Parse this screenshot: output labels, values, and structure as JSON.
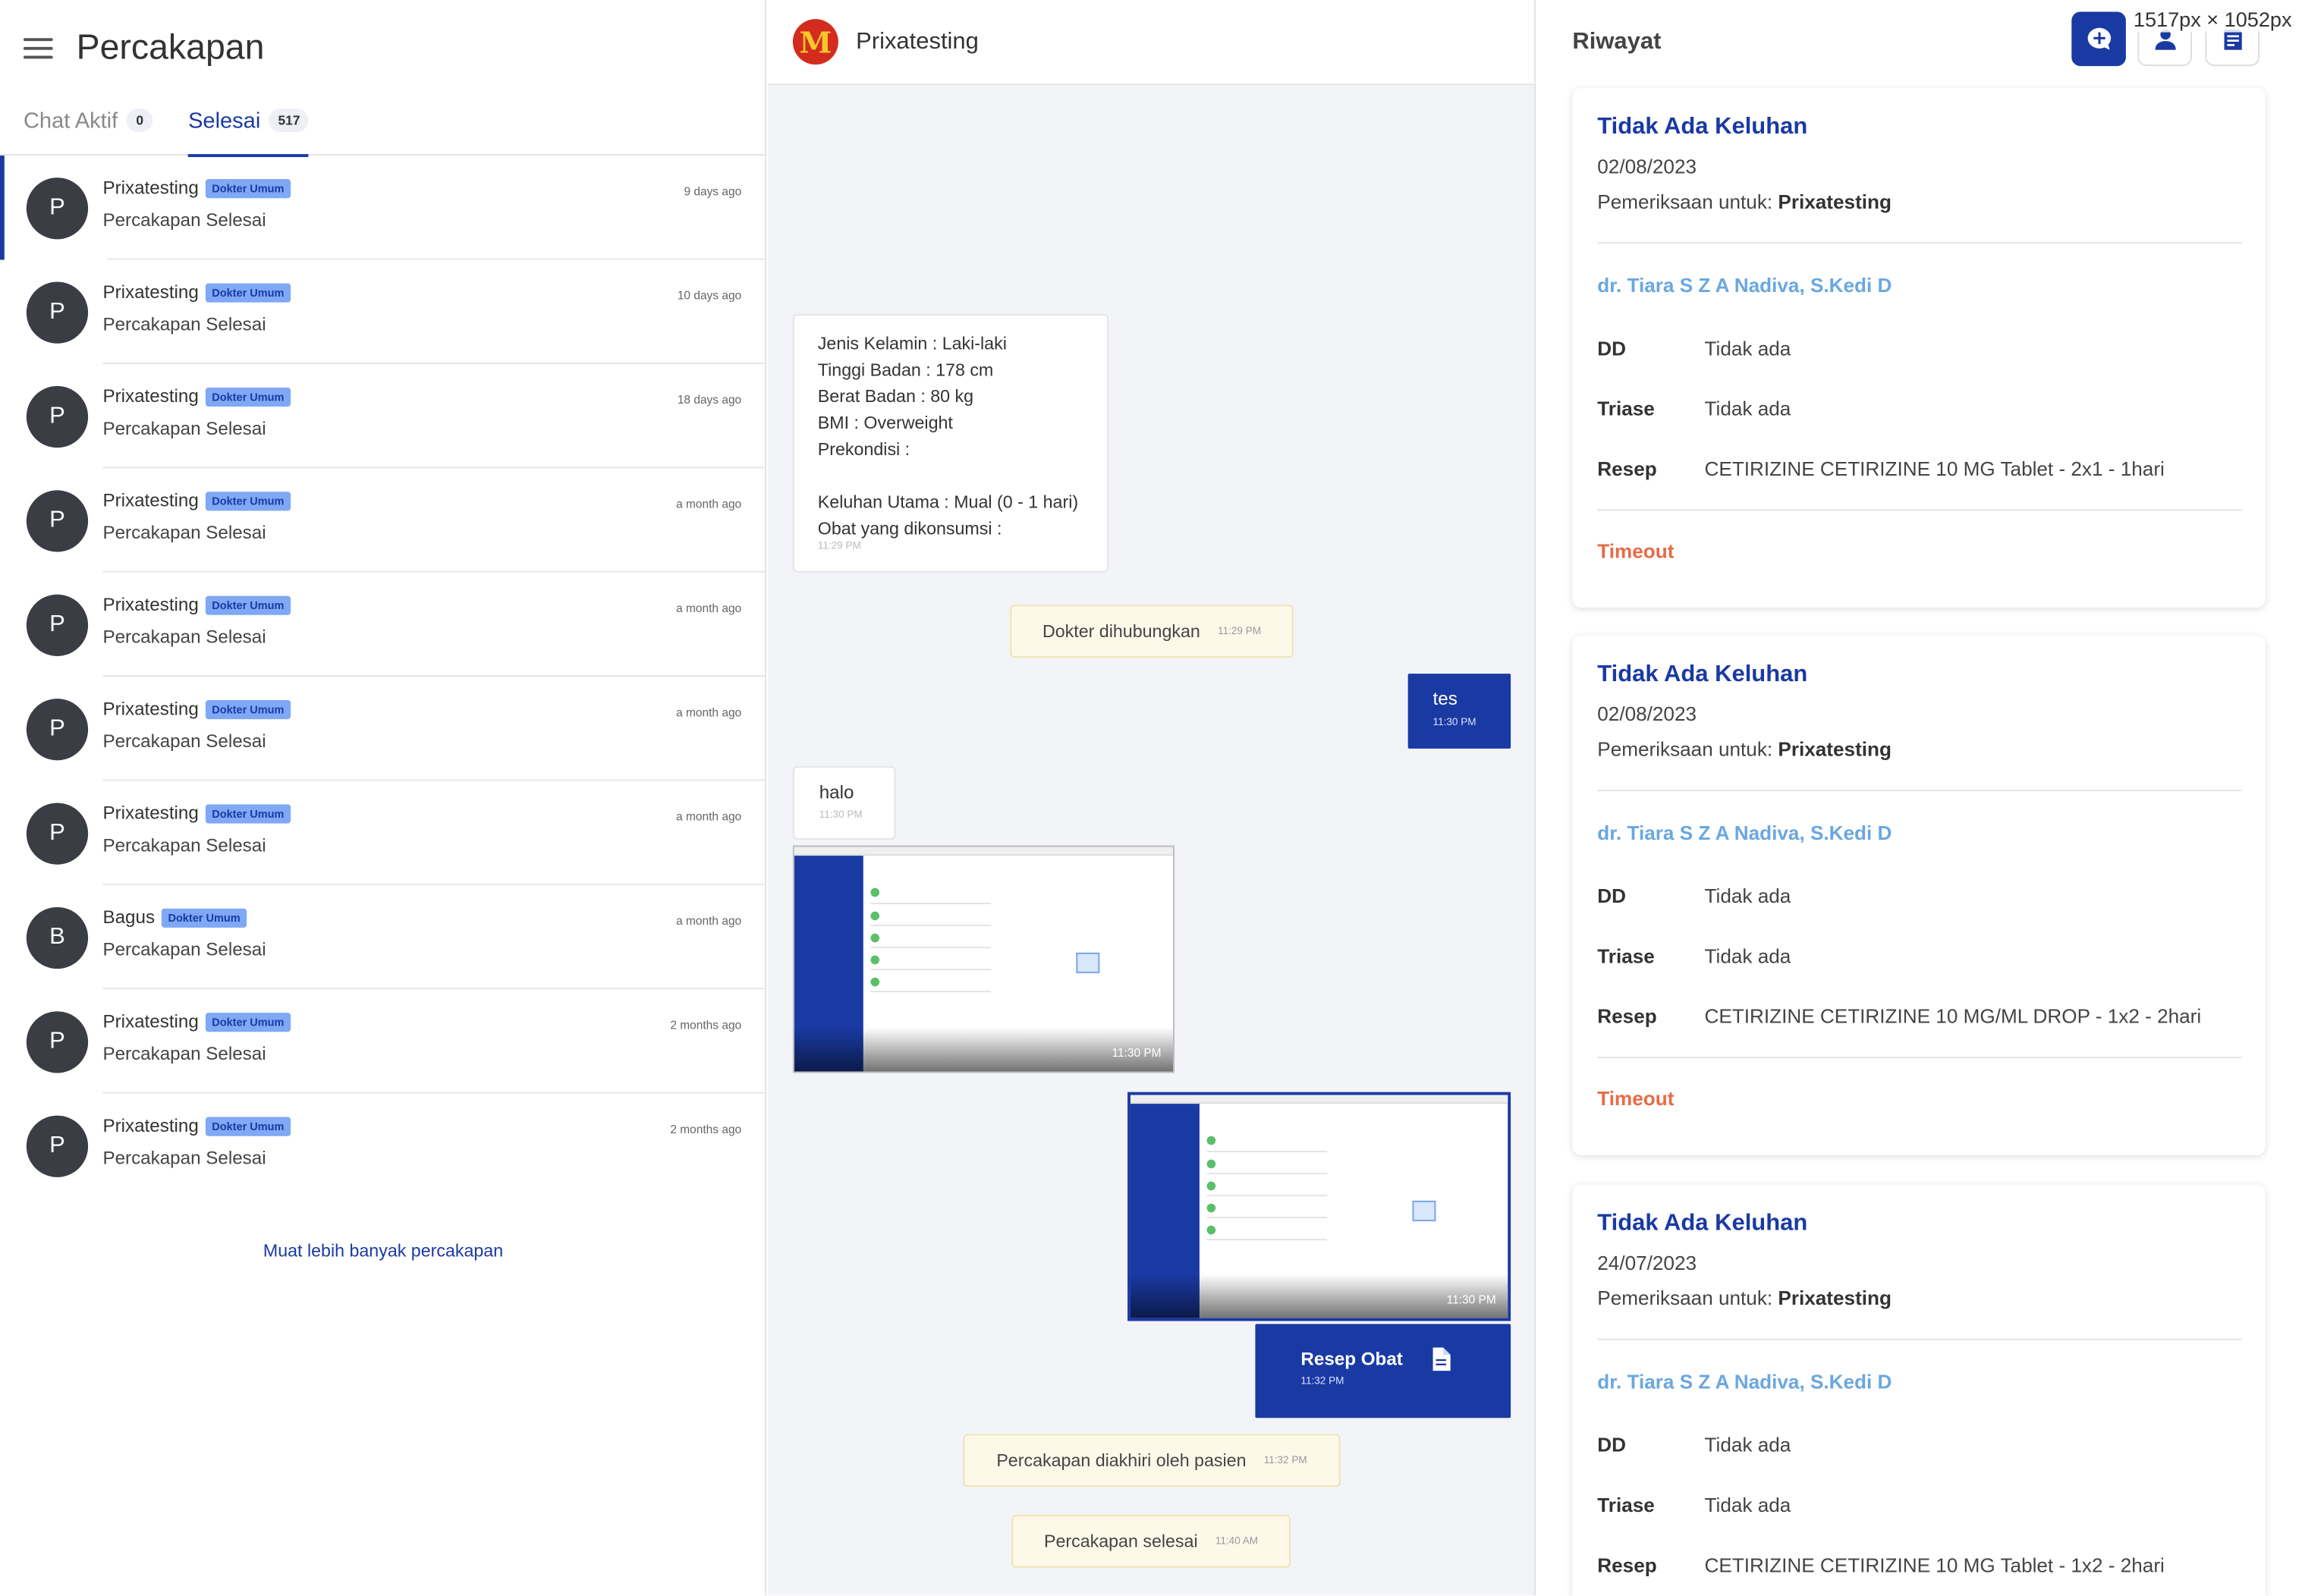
{
  "screen_size_label": "1517px × 1052px",
  "left": {
    "title": "Percakapan",
    "tabs": [
      {
        "label": "Chat Aktif",
        "count": "0"
      },
      {
        "label": "Selesai",
        "count": "517"
      }
    ],
    "items": [
      {
        "avatar": "P",
        "name": "Prixatesting",
        "badge": "Dokter Umum",
        "status": "Percakapan Selesai",
        "time": "9 days ago"
      },
      {
        "avatar": "P",
        "name": "Prixatesting",
        "badge": "Dokter Umum",
        "status": "Percakapan Selesai",
        "time": "10 days ago"
      },
      {
        "avatar": "P",
        "name": "Prixatesting",
        "badge": "Dokter Umum",
        "status": "Percakapan Selesai",
        "time": "18 days ago"
      },
      {
        "avatar": "P",
        "name": "Prixatesting",
        "badge": "Dokter Umum",
        "status": "Percakapan Selesai",
        "time": "a month ago"
      },
      {
        "avatar": "P",
        "name": "Prixatesting",
        "badge": "Dokter Umum",
        "status": "Percakapan Selesai",
        "time": "a month ago"
      },
      {
        "avatar": "P",
        "name": "Prixatesting",
        "badge": "Dokter Umum",
        "status": "Percakapan Selesai",
        "time": "a month ago"
      },
      {
        "avatar": "P",
        "name": "Prixatesting",
        "badge": "Dokter Umum",
        "status": "Percakapan Selesai",
        "time": "a month ago"
      },
      {
        "avatar": "B",
        "name": "Bagus",
        "badge": "Dokter Umum",
        "status": "Percakapan Selesai",
        "time": "a month ago"
      },
      {
        "avatar": "P",
        "name": "Prixatesting",
        "badge": "Dokter Umum",
        "status": "Percakapan Selesai",
        "time": "2 months ago"
      },
      {
        "avatar": "P",
        "name": "Prixatesting",
        "badge": "Dokter Umum",
        "status": "Percakapan Selesai",
        "time": "2 months ago"
      }
    ],
    "load_more": "Muat lebih banyak percakapan"
  },
  "chat": {
    "title": "Prixatesting",
    "logo": "M",
    "intro_lines": [
      "Jenis Kelamin : Laki-laki",
      "Tinggi Badan : 178 cm",
      "Berat Badan : 80 kg",
      "BMI : Overweight",
      "Prekondisi :",
      "",
      "Keluhan Utama : Mual (0 - 1 hari)",
      "Obat yang dikonsumsi :"
    ],
    "intro_time": "11:29 PM",
    "sys1": {
      "text": "Dokter dihubungkan",
      "time": "11:29 PM"
    },
    "out1": {
      "text": "tes",
      "time": "11:30 PM"
    },
    "in1": {
      "text": "halo",
      "time": "11:30 PM"
    },
    "img1_time": "11:30 PM",
    "img2_time": "11:30 PM",
    "resep": {
      "text": "Resep Obat",
      "time": "11:32 PM"
    },
    "sys2": {
      "text": "Percakapan diakhiri oleh pasien",
      "time": "11:32 PM"
    },
    "sys3": {
      "text": "Percakapan selesai",
      "time": "11:40 AM"
    }
  },
  "history": {
    "title": "Riwayat",
    "cards": [
      {
        "title": "Tidak Ada Keluhan",
        "date": "02/08/2023",
        "for_label": "Pemeriksaan untuk: ",
        "for_name": "Prixatesting",
        "doctor": "dr. Tiara S Z A Nadiva, S.Kedi D",
        "dd_label": "DD",
        "dd": "Tidak ada",
        "triase_label": "Triase",
        "triase": "Tidak ada",
        "resep_label": "Resep",
        "resep": "CETIRIZINE CETIRIZINE 10 MG Tablet - 2x1 - 1hari",
        "status": "Timeout"
      },
      {
        "title": "Tidak Ada Keluhan",
        "date": "02/08/2023",
        "for_label": "Pemeriksaan untuk: ",
        "for_name": "Prixatesting",
        "doctor": "dr. Tiara S Z A Nadiva, S.Kedi D",
        "dd_label": "DD",
        "dd": "Tidak ada",
        "triase_label": "Triase",
        "triase": "Tidak ada",
        "resep_label": "Resep",
        "resep": "CETIRIZINE CETIRIZINE 10 MG/ML DROP - 1x2 - 2hari",
        "status": "Timeout"
      },
      {
        "title": "Tidak Ada Keluhan",
        "date": "24/07/2023",
        "for_label": "Pemeriksaan untuk: ",
        "for_name": "Prixatesting",
        "doctor": "dr. Tiara S Z A Nadiva, S.Kedi D",
        "dd_label": "DD",
        "dd": "Tidak ada",
        "triase_label": "Triase",
        "triase": "Tidak ada",
        "resep_label": "Resep",
        "resep": "CETIRIZINE CETIRIZINE 10 MG Tablet - 1x2 - 2hari"
      }
    ]
  },
  "colors": {
    "primary": "#1a3aa3",
    "badge": "#7fa8f5",
    "doctor": "#6aa7e0",
    "timeout": "#e86a45",
    "system_bg": "#fdf8e8"
  },
  "icons": {
    "menu": "menu-icon",
    "chat": "chat-add-icon",
    "user": "user-icon",
    "doc": "document-icon"
  }
}
